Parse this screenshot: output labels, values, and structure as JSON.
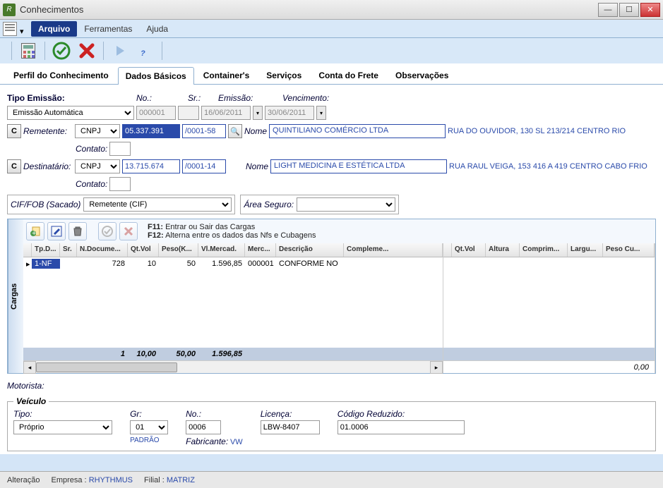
{
  "window": {
    "title": "Conhecimentos"
  },
  "menu": {
    "arquivo": "Arquivo",
    "ferramentas": "Ferramentas",
    "ajuda": "Ajuda"
  },
  "tabs": {
    "perfil": "Perfil do Conhecimento",
    "dados": "Dados Básicos",
    "containers": "Container's",
    "servicos": "Serviços",
    "conta": "Conta do Frete",
    "obs": "Observações"
  },
  "emissao": {
    "tipo_label": "Tipo Emissão:",
    "tipo_value": "Emissão Automática",
    "no_label": "No.:",
    "no_value": "000001",
    "sr_label": "Sr.:",
    "sr_value": "",
    "emissao_label": "Emissão:",
    "emissao_value": "16/06/2011",
    "venc_label": "Vencimento:",
    "venc_value": "30/06/2011"
  },
  "remetente": {
    "label": "Remetente:",
    "doc_type": "CNPJ",
    "cnpj_a": "05.337.391",
    "cnpj_b": "/0001-58",
    "nome_label": "Nome",
    "nome": "QUINTILIANO COMÉRCIO LTDA",
    "endereco": "RUA DO OUVIDOR, 130 SL 213/214 CENTRO RIO",
    "contato_label": "Contato:"
  },
  "destinatario": {
    "label": "Destinatário:",
    "doc_type": "CNPJ",
    "cnpj_a": "13.715.674",
    "cnpj_b": "/0001-14",
    "nome_label": "Nome",
    "nome": "LIGHT MEDICINA E ESTÉTICA LTDA",
    "endereco": "RUA RAUL VEIGA, 153 416 A 419 CENTRO CABO FRIO",
    "contato_label": "Contato:"
  },
  "ciffob": {
    "label": "CIF/FOB  (Sacado)",
    "value": "Remetente (CIF)",
    "area_label": "Área Seguro:"
  },
  "cargas": {
    "tab": "Cargas",
    "hint1_key": "F11:",
    "hint1": "Entrar ou Sair das Cargas",
    "hint2_key": "F12:",
    "hint2": "Alterna entre os dados das Nfs e Cubagens",
    "headers_l": {
      "tpd": "Tp.D...",
      "sr": "Sr.",
      "ndoc": "N.Docume...",
      "qtvol": "Qt.Vol",
      "peso": "Peso(K...",
      "vlmerc": "Vl.Mercad.",
      "merc": "Merc...",
      "desc": "Descrição",
      "compl": "Compleme..."
    },
    "headers_r": {
      "qtvol": "Qt.Vol",
      "altura": "Altura",
      "comprim": "Comprim...",
      "largu": "Largu...",
      "pesocu": "Peso Cu..."
    },
    "row": {
      "tpd": "1-NF",
      "sr": "",
      "ndoc": "728",
      "qtvol": "10",
      "peso": "50",
      "vlmerc": "1.596,85",
      "merc": "000001",
      "desc": "CONFORME NO"
    },
    "sum": {
      "count": "1",
      "qtvol": "10,00",
      "peso": "50,00",
      "vlmerc": "1.596,85"
    },
    "right_total": "0,00"
  },
  "motorista": {
    "label": "Motorista:"
  },
  "veiculo": {
    "legend": "Veículo",
    "tipo_label": "Tipo:",
    "tipo_value": "Próprio",
    "gr_label": "Gr:",
    "gr_value": "01",
    "gr_note": "PADRÃO",
    "no_label": "No.:",
    "no_value": "0006",
    "lic_label": "Licença:",
    "lic_value": "LBW-8407",
    "cod_label": "Código Reduzido:",
    "cod_value": "01.0006",
    "fab_label": "Fabricante:",
    "fab_value": "VW"
  },
  "status": {
    "mode": "Alteração",
    "emp_label": "Empresa :",
    "emp": "RHYTHMUS",
    "fil_label": "Filial :",
    "fil": "MATRIZ"
  }
}
